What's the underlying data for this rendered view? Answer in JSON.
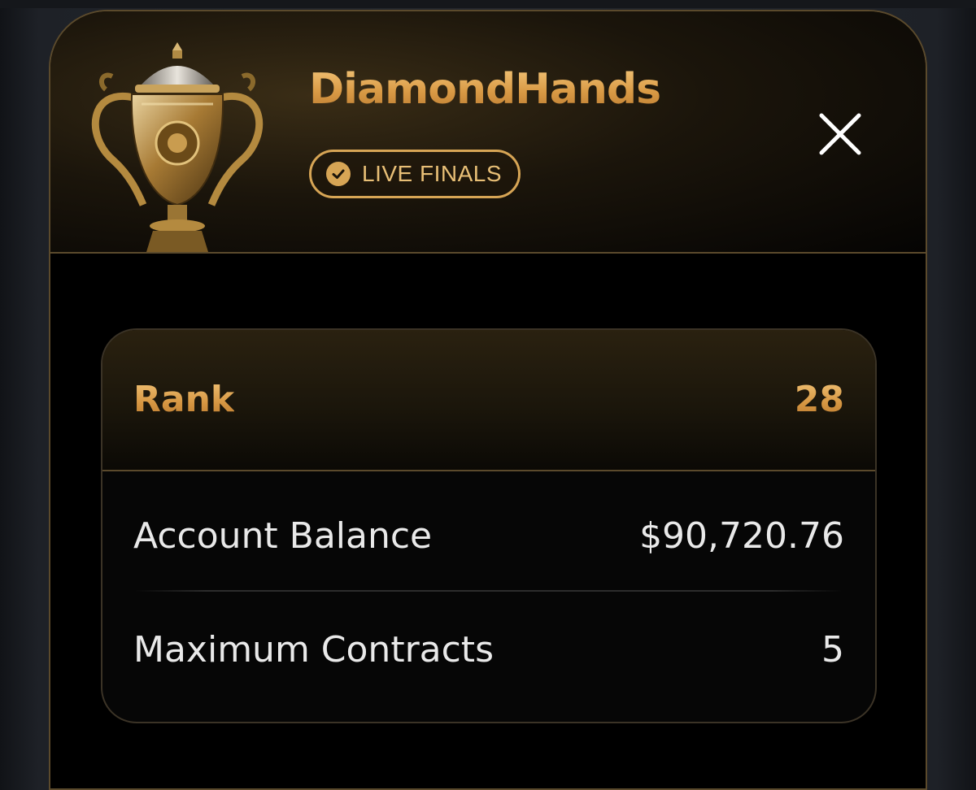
{
  "header": {
    "player_name": "DiamondHands",
    "badge_label": "LIVE FINALS",
    "badge_icon": "check-circle-icon",
    "trophy_icon": "trophy-icon",
    "close_icon": "close-icon"
  },
  "stats": {
    "rank_label": "Rank",
    "rank_value": "28",
    "balance_label": "Account Balance",
    "balance_value": "$90,720.76",
    "contracts_label": "Maximum Contracts",
    "contracts_value": "5"
  },
  "colors": {
    "gold": "#d7a555",
    "border": "#5b4a2c",
    "background": "#000000",
    "text": "#e9e9e9"
  }
}
